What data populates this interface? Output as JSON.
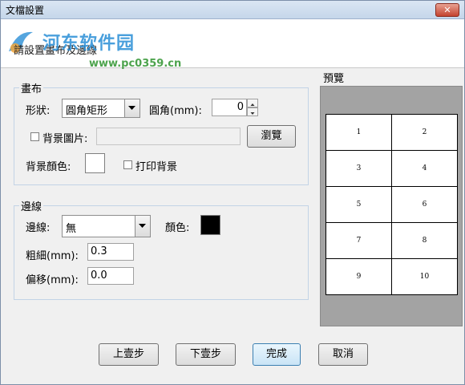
{
  "window": {
    "title": "文檔設置",
    "close_label": "✕"
  },
  "banner": {
    "hint": "請設置畫布及邊線",
    "watermark_big": "河东软件园",
    "watermark_url": "www.pc0359.cn"
  },
  "canvas_group": {
    "legend": "畫布",
    "shape_label": "形狀:",
    "shape_value": "圓角矩形",
    "corner_label": "圓角(mm):",
    "corner_value": "0",
    "bg_image_label": "背景圖片:",
    "browse_label": "瀏覽",
    "bg_color_label": "背景顏色:",
    "print_bg_label": "打印背景",
    "bg_color_hex": "#ffffff"
  },
  "border_group": {
    "legend": "邊線",
    "border_label": "邊線:",
    "border_value": "無",
    "color_label": "顏色:",
    "color_hex": "#000000",
    "thickness_label": "粗細(mm):",
    "thickness_value": "0.3",
    "offset_label": "偏移(mm):",
    "offset_value": "0.0"
  },
  "preview": {
    "legend": "預覽",
    "cells": [
      [
        "1",
        "2"
      ],
      [
        "3",
        "4"
      ],
      [
        "5",
        "6"
      ],
      [
        "7",
        "8"
      ],
      [
        "9",
        "10"
      ]
    ]
  },
  "footer": {
    "prev_label": "上壹步",
    "next_label": "下壹步",
    "finish_label": "完成",
    "cancel_label": "取消"
  }
}
